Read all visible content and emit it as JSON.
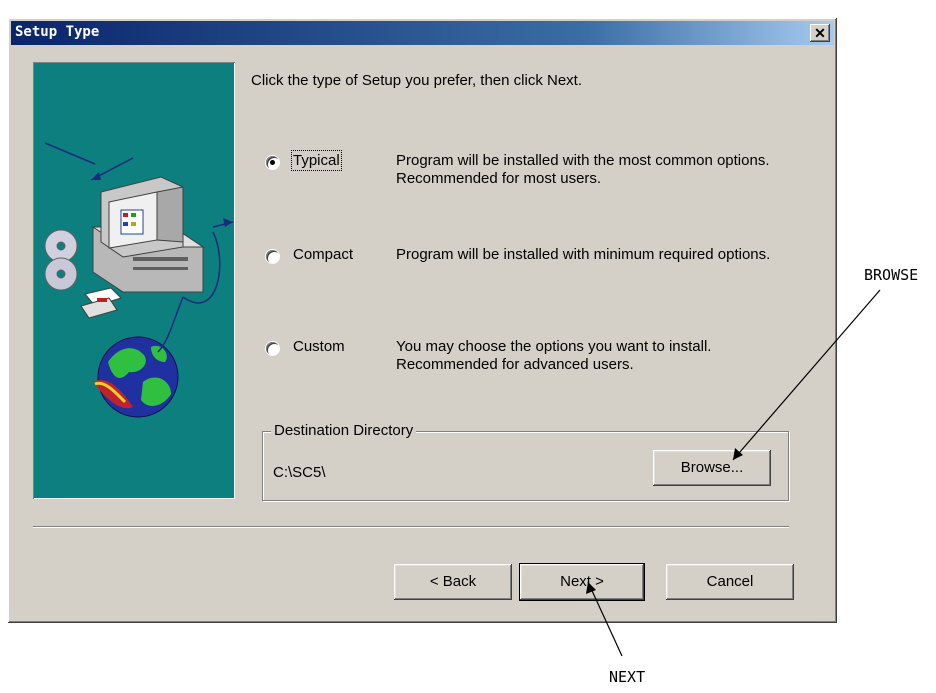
{
  "window": {
    "title": "Setup Type",
    "close_glyph": "✕"
  },
  "prompt": "Click the type of Setup you prefer, then click Next.",
  "options": [
    {
      "label": "Typical",
      "selected": true,
      "desc": "Program will be installed with the most common options. Recommended for most users."
    },
    {
      "label": "Compact",
      "selected": false,
      "desc": "Program will be installed with minimum required options."
    },
    {
      "label": "Custom",
      "selected": false,
      "desc": "You may choose the options you want to install. Recommended for advanced users."
    }
  ],
  "destination": {
    "label": "Destination Directory",
    "path": "C:\\SC5\\",
    "browse_label": "Browse..."
  },
  "buttons": {
    "back": "< Back",
    "next": "Next >",
    "cancel": "Cancel"
  },
  "annotations": {
    "browse": "BROWSE",
    "next": "NEXT"
  },
  "colors": {
    "title_bar": "#0a246a",
    "art_bg": "#0d7f7f",
    "dialog_bg": "#d4d0c8"
  },
  "icons": [
    "computer-icon",
    "cd-disc-icon",
    "floppy-disk-icon",
    "globe-icon"
  ]
}
